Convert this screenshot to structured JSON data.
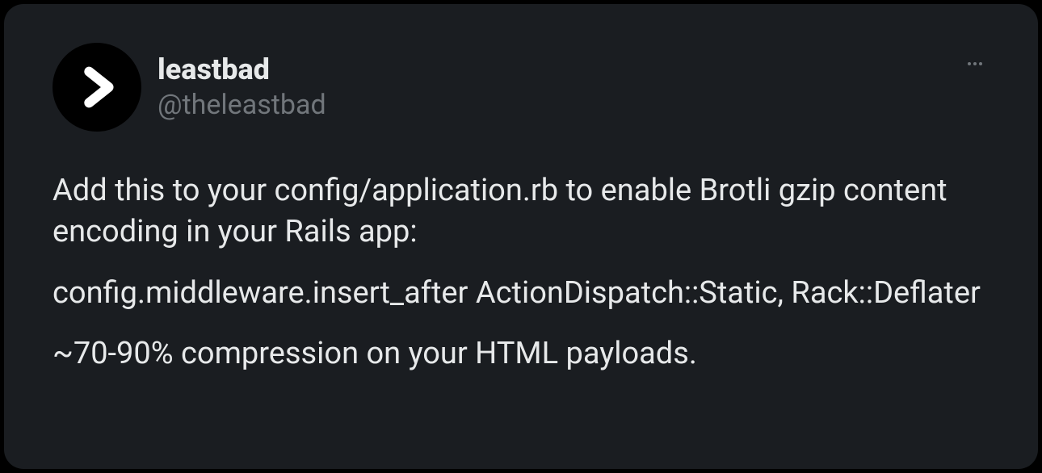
{
  "tweet": {
    "author": {
      "display_name": "leastbad",
      "handle": "@theleastbad",
      "avatar_icon": "chevron-right"
    },
    "content": {
      "paragraphs": [
        "Add this to your config/application.rb to enable Brotli gzip content encoding in your Rails app:",
        "config.middleware.insert_after ActionDispatch::Static, Rack::Deflater",
        "~70-90% compression on your HTML payloads."
      ]
    }
  }
}
